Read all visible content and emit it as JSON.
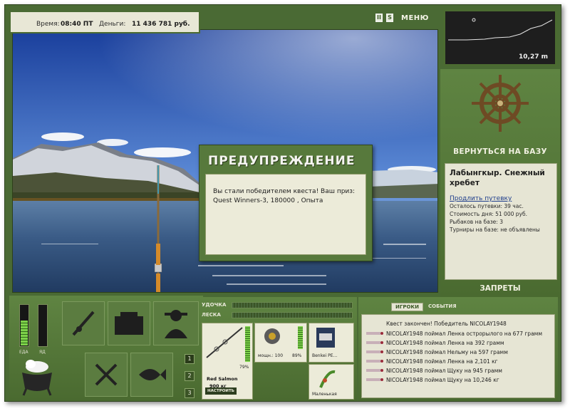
{
  "status": {
    "time_label": "Время:",
    "time_value": "08:40 ПТ",
    "money_label": "Деньги:",
    "money_value": "11 436 781 руб."
  },
  "top_icons": {
    "pause": "II",
    "sound": "S",
    "menu_label": "МЕНЮ"
  },
  "depth": {
    "value": "10,27 m"
  },
  "right_panel": {
    "return_label": "ВЕРНУТЬСЯ НА БАЗУ",
    "location_title": "Лабынгкыр. Снежный хребет",
    "extend_link": "Продлить путевку",
    "lines": [
      "Осталось путевки: 39 час.",
      "Стоимость дня: 51 000 руб.",
      "Рыбаков на базе: 3",
      "Турниры на базе: не объявлены"
    ],
    "bans_label": "ЗАПРЕТЫ"
  },
  "modal": {
    "title": "ПРЕДУПРЕЖДЕНИЕ",
    "message": "Вы стали победителем квеста! Ваш приз: Quest Winners-3, 180000 , Опыта"
  },
  "meters": {
    "food_label": "ЕДА",
    "poison_label": "ЯД",
    "food_level": 0.6,
    "poison_level": 0.0
  },
  "tool_slots": [
    "1",
    "2",
    "3"
  ],
  "gear": {
    "rod_label": "УДОЧКА",
    "line_label": "ЛЕСКА",
    "rod_percent": "79%",
    "rod_name": "Red Salmon",
    "rod_weight": "900 кг",
    "setup_label": "НАСТРОИТЬ",
    "reel_power": "мощн.: 100",
    "reel_percent": "89%",
    "line_name": "Benkei PE...",
    "lure_name": "Маленькая"
  },
  "log": {
    "tab_players": "ИГРОКИ",
    "tab_events": "СОБЫТИЯ",
    "first_line": "Квест закончен! Победитель NICOLAY1948",
    "items": [
      "NICOLAY1948 поймал Ленка острорылого на 677 грамм",
      "NICOLAY1948 поймал Ленка на 392 грамм",
      "NICOLAY1948 поймал Нельму на 597 грамм",
      "NICOLAY1948 поймал Ленка на 2,101 кг",
      "NICOLAY1948 поймал Щуку на 945 грамм",
      "NICOLAY1948 поймал Щуку на 10,246 кг"
    ]
  },
  "colors": {
    "panel_green": "#4a6a34",
    "cream": "#e8e7d6",
    "meter_green": "#7ed24a"
  }
}
